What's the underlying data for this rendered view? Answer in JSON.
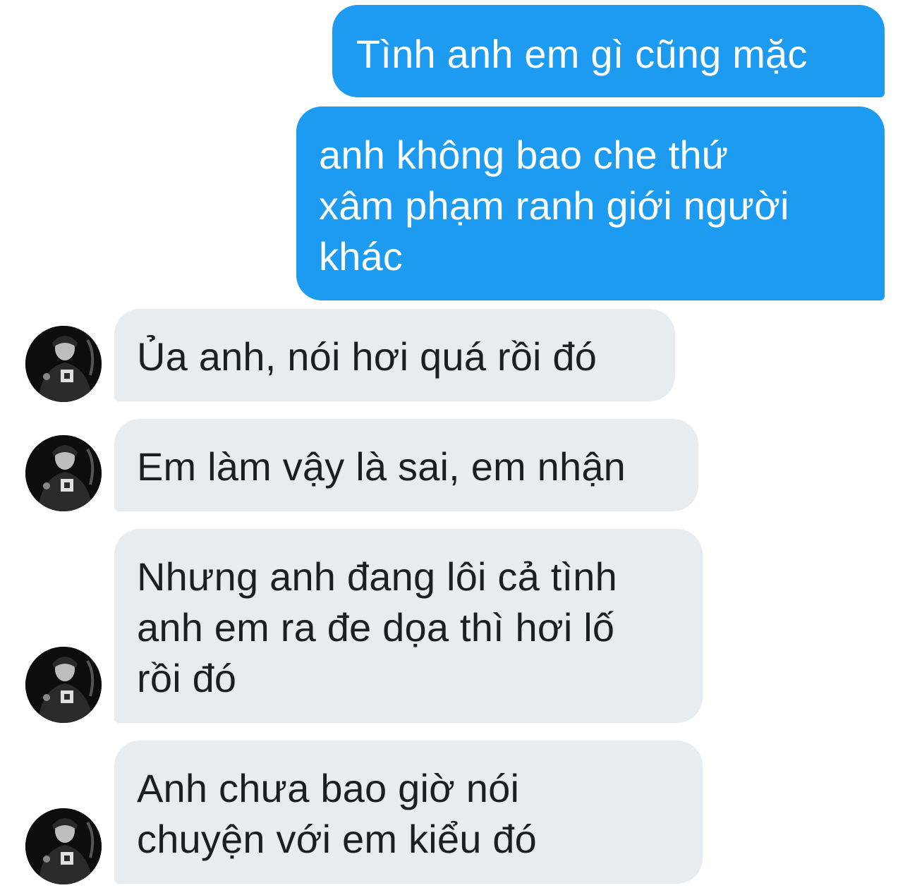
{
  "conversation": {
    "messages": [
      {
        "direction": "outgoing",
        "lines": [
          "Tình anh em gì cũng mặc"
        ]
      },
      {
        "direction": "outgoing",
        "lines": [
          "anh không bao che thứ",
          "xâm phạm ranh giới người",
          "khác"
        ]
      },
      {
        "direction": "incoming",
        "lines": [
          "Ủa anh, nói hơi quá rồi đó"
        ]
      },
      {
        "direction": "incoming",
        "lines": [
          "Em làm vậy là sai, em nhận"
        ]
      },
      {
        "direction": "incoming",
        "lines": [
          "Nhưng anh đang lôi cả tình",
          "anh em ra đe dọa thì hơi lố",
          "rồi đó"
        ]
      },
      {
        "direction": "incoming",
        "lines": [
          "Anh chưa bao giờ nói",
          "chuyện với em kiểu đó"
        ]
      }
    ]
  },
  "colors": {
    "outgoing_bubble": "#1d9bf0",
    "incoming_bubble": "#e7ecf0",
    "incoming_text": "#1b1f23",
    "outgoing_text": "#ffffff"
  },
  "icons": {
    "avatar": "contact-avatar-photo"
  }
}
